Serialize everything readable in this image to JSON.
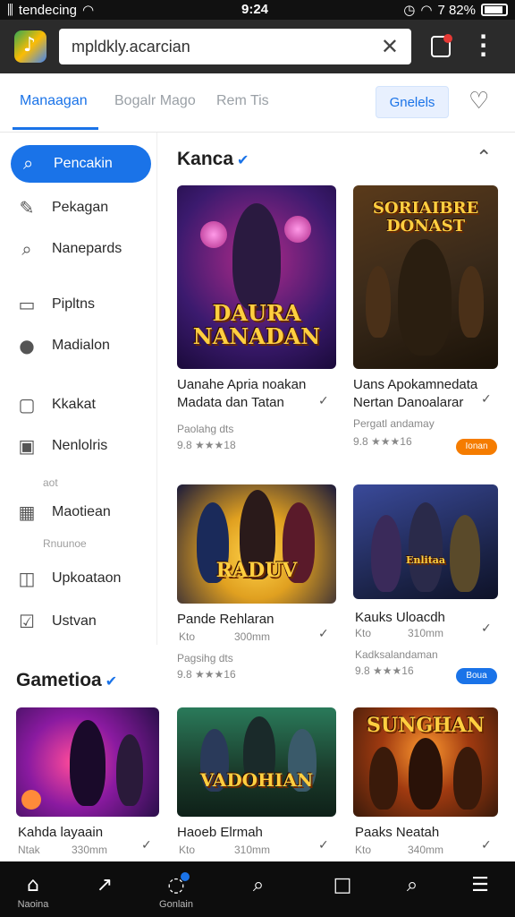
{
  "status_bar": {
    "carrier": "tendecing",
    "time": "9:24",
    "battery": "7 82%"
  },
  "browser": {
    "url": "mpldkly.acarcian"
  },
  "tabs": [
    {
      "label": "Manaagan",
      "active": true
    },
    {
      "label": "Bogalr Mago",
      "active": false
    },
    {
      "label": "Rem Tis",
      "active": false
    }
  ],
  "tab_button": "Gnelels",
  "sidebar": {
    "active": {
      "label": "Pencakin",
      "icon": "search-icon"
    },
    "items": [
      {
        "label": "Pekagan",
        "icon": "edit-icon"
      },
      {
        "label": "Nanepards",
        "icon": "search-icon"
      },
      {
        "label": "Pipltns",
        "icon": "briefcase-icon"
      },
      {
        "label": "Madialon",
        "icon": "magnifier-icon"
      },
      {
        "label": "Kkakat",
        "icon": "document-icon"
      },
      {
        "label": "Nenlolris",
        "icon": "square-icon"
      },
      {
        "label": "Maotiean",
        "icon": "calendar-icon"
      },
      {
        "label": "Upkoataon",
        "icon": "frame-icon"
      },
      {
        "label": "Ustvan",
        "icon": "checkbox-icon"
      }
    ],
    "sublabels": [
      "aot",
      "Rnuunoe"
    ]
  },
  "sections": [
    {
      "title": "Kanca",
      "verified": true
    },
    {
      "title": "Gametioa",
      "verified": true
    }
  ],
  "cards": [
    {
      "art": "DAURA NANADAN",
      "title1": "Uanahe Apria noakan",
      "title2": "Madata dan Tatan",
      "meta1": "Paolahg dts",
      "meta2": "9.8 ★★★18",
      "badge": "",
      "colors": [
        "#3b1a6e",
        "#b02a8a",
        "#ff6ad5"
      ]
    },
    {
      "art": "SORIAIBRE DONAST",
      "title1": "Uans Apokamnedata",
      "title2": "Nertan Danoalarar",
      "meta1": "Pergatl andamay",
      "meta2": "9.8 ★★★16",
      "badge": "Ionan",
      "colors": [
        "#3a2a1a",
        "#a3521a",
        "#ffb040"
      ]
    },
    {
      "art": "RADUV",
      "title1": "Pande Rehlaran",
      "title2": "",
      "meta1": "Kto",
      "meta2": "300mm",
      "meta3": "Pagsihg dts",
      "meta4": "9.8 ★★★16",
      "badge": "",
      "colors": [
        "#1a1a3a",
        "#e0a020",
        "#ffd34a"
      ]
    },
    {
      "art": "Enlitaa",
      "title1": "Kauks Uloacdh",
      "title2": "",
      "meta1": "Kto",
      "meta2": "310mm",
      "meta3": "Kadksalandaman",
      "meta4": "9.8 ★★★16",
      "badge": "Boua",
      "colors": [
        "#1a2246",
        "#3a4a9a",
        "#8aa6ff"
      ]
    },
    {
      "art": "",
      "title1": "Kahda layaain",
      "title2": "",
      "meta1": "Ntak",
      "meta2": "330mm",
      "colors": [
        "#2a0f4a",
        "#8a1aa0",
        "#ff4a9a"
      ]
    },
    {
      "art": "VADOHIAN",
      "title1": "Haoeb Elrmah",
      "title2": "",
      "meta1": "Kto",
      "meta2": "310mm",
      "colors": [
        "#1a3a2a",
        "#2a7a5a",
        "#ffd040"
      ]
    },
    {
      "art": "SUNGHAN",
      "title1": "Paaks Neatah",
      "title2": "",
      "meta1": "Kto",
      "meta2": "340mm",
      "colors": [
        "#3a1a0a",
        "#a03a10",
        "#ff9a30"
      ]
    }
  ],
  "bottom_nav": [
    {
      "label": "Naoina",
      "icon": "home-icon"
    },
    {
      "label": "",
      "icon": "share-icon"
    },
    {
      "label": "Gonlain",
      "icon": "chat-icon"
    },
    {
      "label": "",
      "icon": "search-icon"
    },
    {
      "label": "",
      "icon": "square-icon"
    },
    {
      "label": "",
      "icon": "search-icon"
    },
    {
      "label": "",
      "icon": "menu-icon"
    }
  ],
  "colors": {
    "accent": "#1a73e8",
    "badge_orange": "#f57c00",
    "badge_blue": "#1a73e8"
  }
}
